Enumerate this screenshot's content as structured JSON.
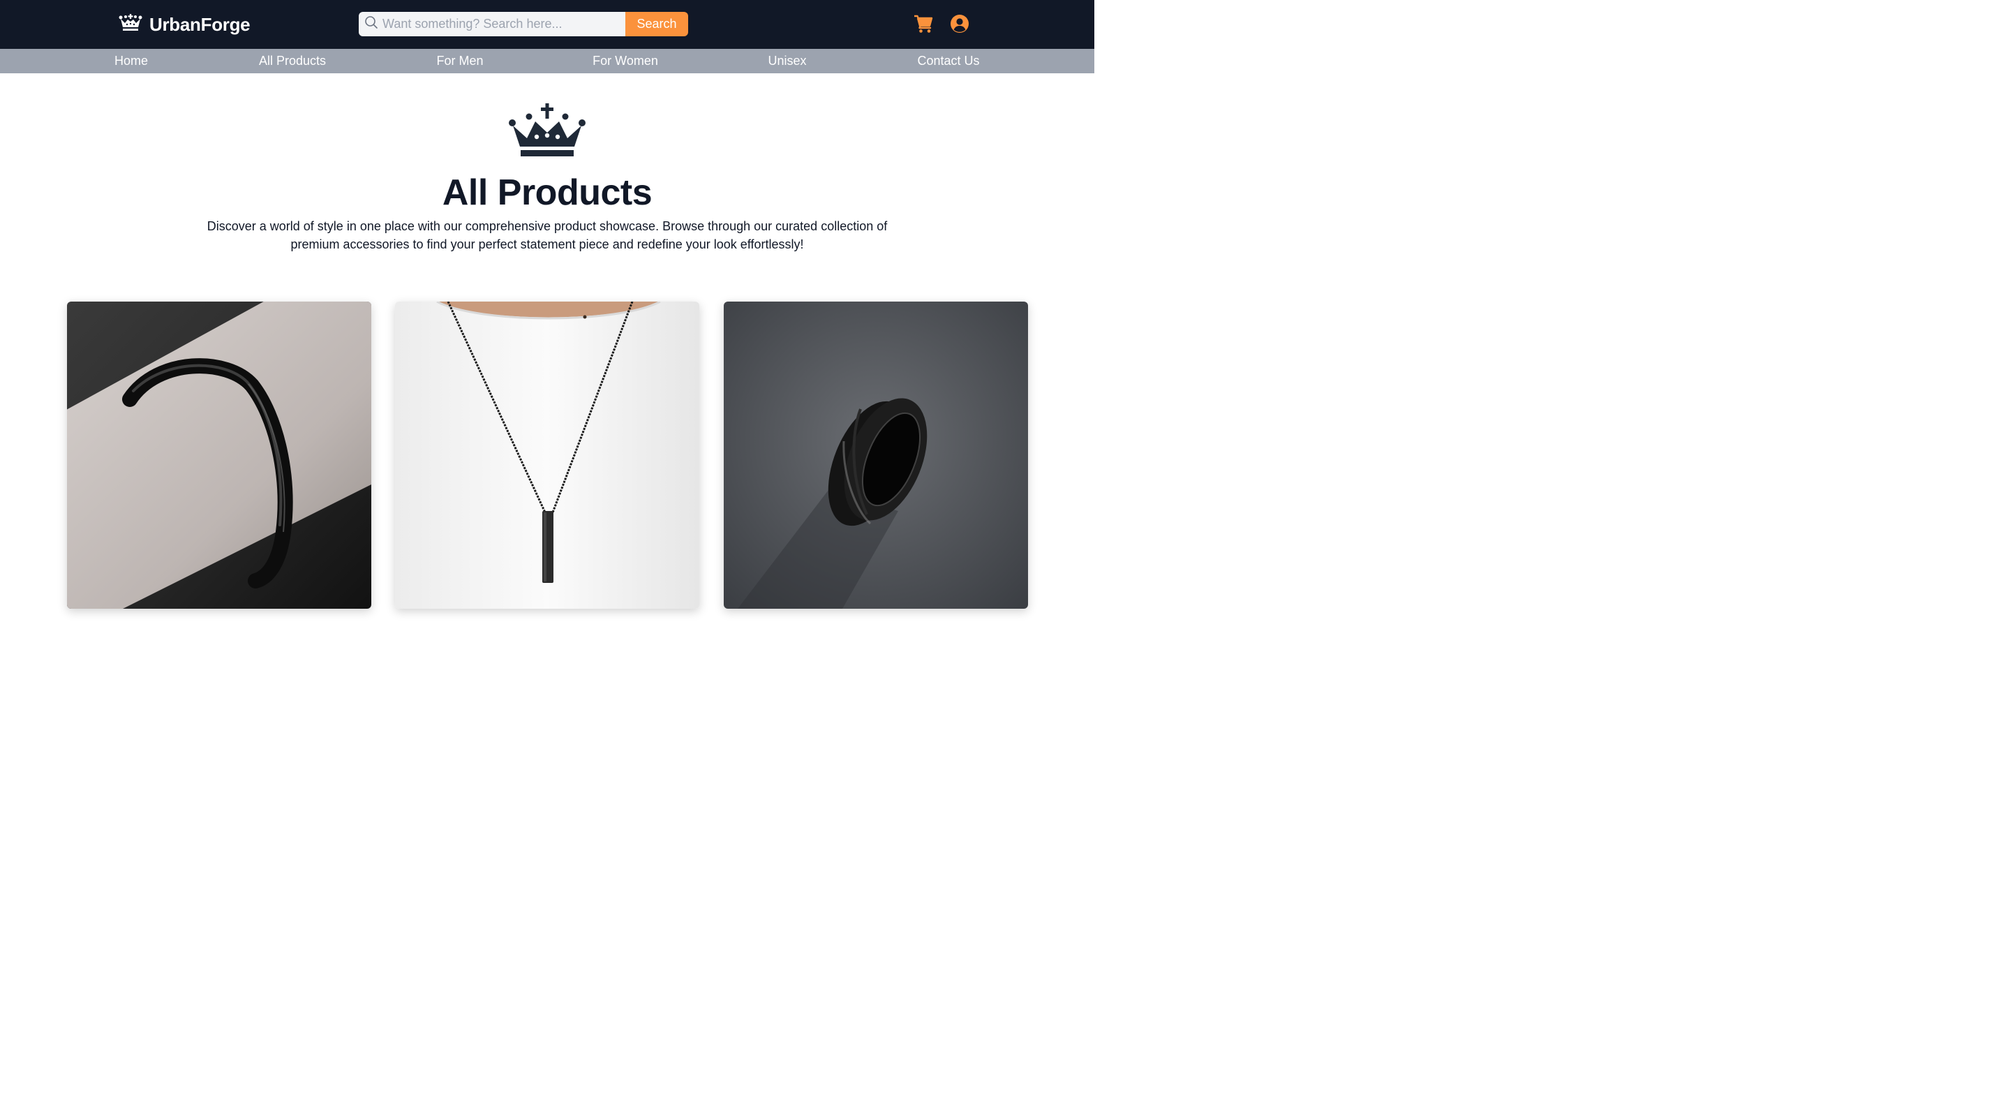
{
  "header": {
    "brand_name": "UrbanForge",
    "search": {
      "placeholder": "Want something? Search here...",
      "value": "",
      "button_label": "Search"
    },
    "icons": [
      "cart-icon",
      "user-account-icon"
    ]
  },
  "nav": {
    "items": [
      {
        "label": "Home"
      },
      {
        "label": "All Products"
      },
      {
        "label": "For Men"
      },
      {
        "label": "For Women"
      },
      {
        "label": "Unisex"
      },
      {
        "label": "Contact Us"
      }
    ]
  },
  "hero": {
    "icon": "crown-icon",
    "title": "All Products",
    "description": "Discover a world of style in one place with our comprehensive product showcase. Browse through our curated collection of premium accessories to find your perfect statement piece and redefine your look effortlessly!"
  },
  "products": [
    {
      "image": "black-bangle-bracelet"
    },
    {
      "image": "black-bar-pendant-necklace"
    },
    {
      "image": "black-ring"
    }
  ],
  "colors": {
    "header_bg": "#111827",
    "nav_bg": "#9ca3af",
    "accent": "#fb923c",
    "text_dark": "#111827"
  }
}
